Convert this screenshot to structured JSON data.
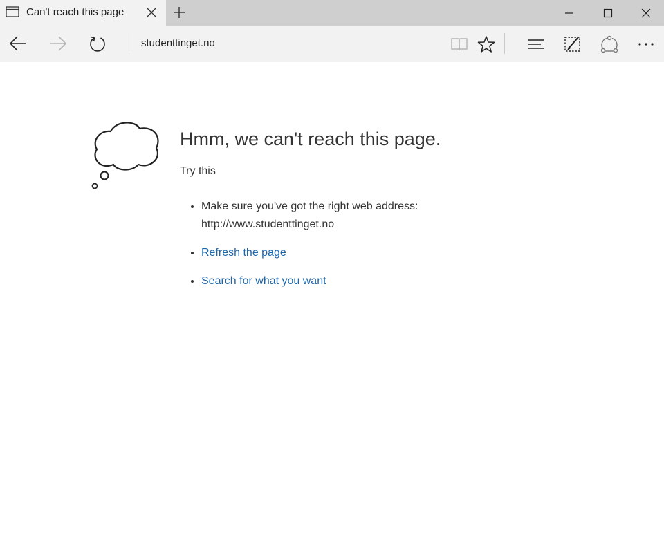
{
  "tab": {
    "title": "Can't reach this page"
  },
  "navbar": {
    "address": "studenttinget.no"
  },
  "error": {
    "heading": "Hmm, we can't reach this page.",
    "try_this": "Try this",
    "suggestions": [
      {
        "text": "Make sure you've got the right web address:",
        "subtext": "http://www.studenttinget.no"
      },
      {
        "text": "Refresh the page"
      },
      {
        "text": "Search for what you want"
      }
    ]
  },
  "colors": {
    "tab_bar": "#cfcfcf",
    "active_tab": "#f2f2f2",
    "link": "#1e66aa",
    "text": "#333333"
  },
  "icons": {
    "tab": "page-icon",
    "tab_close": "close-icon",
    "new_tab": "plus-icon",
    "back": "back-arrow-icon",
    "forward": "forward-arrow-icon",
    "refresh": "refresh-icon",
    "reading_view": "book-icon",
    "favorites": "star-icon",
    "hub": "hub-icon",
    "web_note": "pen-icon",
    "share": "share-icon",
    "more": "more-icon",
    "error": "thought-cloud-icon"
  }
}
